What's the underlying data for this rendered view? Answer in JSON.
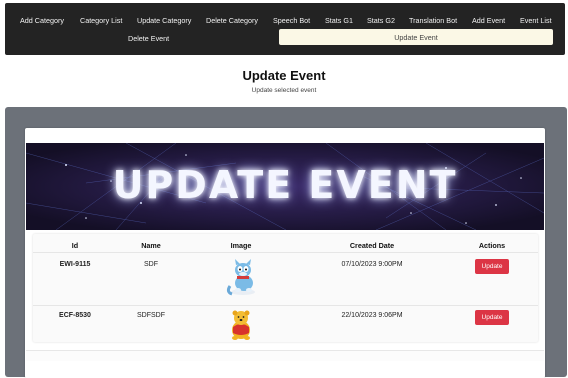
{
  "nav": {
    "items": [
      "Add Category",
      "Category List",
      "Update Category",
      "Delete Category",
      "Speech Bot",
      "Stats G1",
      "Stats G2",
      "Translation Bot",
      "Add Event",
      "Event List"
    ],
    "row2": {
      "delete_event": "Delete Event",
      "update_event": "Update Event"
    }
  },
  "header": {
    "title": "Update Event",
    "subtitle": "Update selected event"
  },
  "banner": {
    "text": "UPDATE EVENT"
  },
  "table": {
    "columns": [
      "Id",
      "Name",
      "Image",
      "Created Date",
      "Actions"
    ],
    "rows": [
      {
        "id": "EWI-9115",
        "name": "SDF",
        "image_icon": "cartoon-cat-icon",
        "created": "07/10/2023 9:00PM",
        "action": "Update"
      },
      {
        "id": "ECF-8530",
        "name": "SDFSDF",
        "image_icon": "cartoon-bear-icon",
        "created": "22/10/2023 9:06PM",
        "action": "Update"
      }
    ]
  },
  "colors": {
    "nav_bg": "#232323",
    "active_tab": "#fbf8e6",
    "update_button": "#dc3545",
    "outer_bg": "#6c7179",
    "banner_bg": "#140f26"
  }
}
